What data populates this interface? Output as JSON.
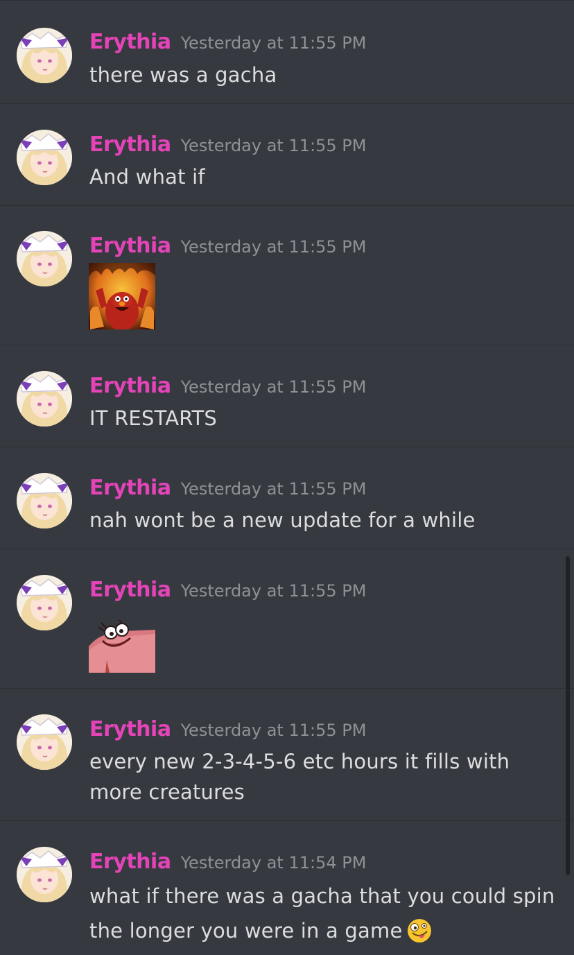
{
  "colors": {
    "background": "#36393f",
    "divider": "#2b2e33",
    "author": "#e544b9",
    "timestamp": "#8e9297",
    "message_text": "#dcddde",
    "scrollbar": "#202225"
  },
  "messages": [
    {
      "author": "Erythia",
      "timestamp": "Yesterday at 11:55 PM",
      "text": "there was a gacha"
    },
    {
      "author": "Erythia",
      "timestamp": "Yesterday at 11:55 PM",
      "text": "And what if"
    },
    {
      "author": "Erythia",
      "timestamp": "Yesterday at 11:55 PM",
      "attachment": "elmo-on-fire-gif"
    },
    {
      "author": "Erythia",
      "timestamp": "Yesterday at 11:55 PM",
      "text": "IT RESTARTS"
    },
    {
      "author": "Erythia",
      "timestamp": "Yesterday at 11:55 PM",
      "text": "nah wont be a new update for a while"
    },
    {
      "author": "Erythia",
      "timestamp": "Yesterday at 11:55 PM",
      "attachment": "evil-patrick-meme"
    },
    {
      "author": "Erythia",
      "timestamp": "Yesterday at 11:55 PM",
      "text": "every new 2-3-4-5-6 etc hours it fills with more creatures"
    },
    {
      "author": "Erythia",
      "timestamp": "Yesterday at 11:54 PM",
      "text": "what if there was a gacha that you could spin the longer you were in a game",
      "emoji": "zany-face-emoji"
    }
  ]
}
